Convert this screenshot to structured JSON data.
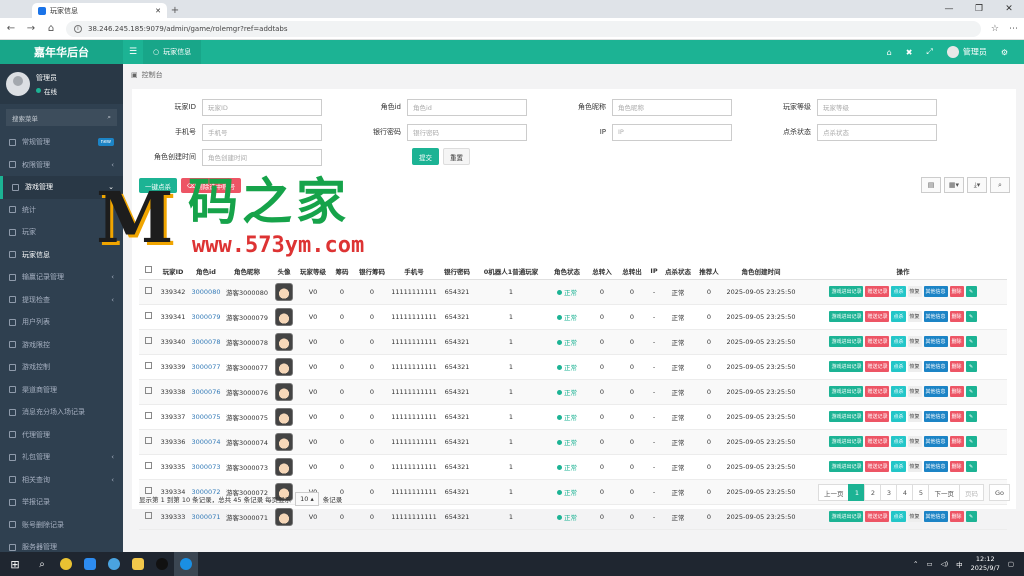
{
  "browser": {
    "tab_title": "玩家信息",
    "url": "38.246.245.185:9079/admin/game/rolemgr?ref=addtabs"
  },
  "app": {
    "brand": "嘉年华后台",
    "active_tab": "玩家信息",
    "admin_name": "管理员",
    "breadcrumb": "控制台"
  },
  "sidebar": {
    "user_name": "管理员",
    "user_status": "在线",
    "search_placeholder": "搜索菜单",
    "items": [
      {
        "label": "常规管理",
        "badge": "new",
        "arrow": ""
      },
      {
        "label": "权限管理",
        "badge": "",
        "arrow": "‹"
      },
      {
        "label": "游戏管理",
        "badge": "",
        "arrow": "⌄"
      },
      {
        "label": "统计",
        "badge": "",
        "arrow": ""
      },
      {
        "label": "玩家",
        "badge": "",
        "arrow": ""
      },
      {
        "label": "玩家信息",
        "badge": "",
        "arrow": ""
      },
      {
        "label": "输赢记录管理",
        "badge": "",
        "arrow": "‹"
      },
      {
        "label": "提现检查",
        "badge": "",
        "arrow": "‹"
      },
      {
        "label": "用户列表",
        "badge": "",
        "arrow": ""
      },
      {
        "label": "游戏限控",
        "badge": "",
        "arrow": ""
      },
      {
        "label": "游戏控制",
        "badge": "",
        "arrow": ""
      },
      {
        "label": "渠道商管理",
        "badge": "",
        "arrow": ""
      },
      {
        "label": "消息充分场入场记录",
        "badge": "",
        "arrow": ""
      },
      {
        "label": "代理管理",
        "badge": "",
        "arrow": ""
      },
      {
        "label": "礼包管理",
        "badge": "",
        "arrow": "‹"
      },
      {
        "label": "相关查询",
        "badge": "",
        "arrow": "‹"
      },
      {
        "label": "举报记录",
        "badge": "",
        "arrow": ""
      },
      {
        "label": "账号删除记录",
        "badge": "",
        "arrow": ""
      },
      {
        "label": "服务器管理",
        "badge": "",
        "arrow": ""
      }
    ]
  },
  "search_form": {
    "fields": [
      {
        "label": "玩家ID",
        "placeholder": "玩家ID"
      },
      {
        "label": "角色id",
        "placeholder": "角色id"
      },
      {
        "label": "角色昵称",
        "placeholder": "角色昵称"
      },
      {
        "label": "玩家等级",
        "placeholder": "玩家等级"
      },
      {
        "label": "手机号",
        "placeholder": "手机号"
      },
      {
        "label": "银行密码",
        "placeholder": "银行密码"
      },
      {
        "label": "IP",
        "placeholder": "IP"
      },
      {
        "label": "点杀状态",
        "placeholder": "点杀状态"
      },
      {
        "label": "角色创建时间",
        "placeholder": "角色创建时间"
      }
    ],
    "submit": "提交",
    "reset": "重置"
  },
  "toolbar": {
    "kill_all": "一键点杀",
    "delete_selected": "删除选中账号"
  },
  "table": {
    "headers": [
      "",
      "玩家ID",
      "角色id",
      "角色昵称",
      "头像",
      "玩家等级",
      "筹码",
      "银行筹码",
      "手机号",
      "银行密码",
      "0机器人1普通玩家",
      "角色状态",
      "总转入",
      "总转出",
      "IP",
      "点杀状态",
      "推荐人",
      "角色创建时间",
      "操作"
    ],
    "rows": [
      {
        "pid": "339342",
        "rid": "3000080",
        "nick": "游客3000080",
        "level": "V0",
        "chips": "0",
        "bank": "0",
        "phone": "11111111111",
        "bankpwd": "654321",
        "type": "1",
        "status": "正常",
        "in": "0",
        "out": "0",
        "ip": "-",
        "kill": "正常",
        "ref": "0",
        "created": "2025-09-05 23:25:50"
      },
      {
        "pid": "339341",
        "rid": "3000079",
        "nick": "游客3000079",
        "level": "V0",
        "chips": "0",
        "bank": "0",
        "phone": "11111111111",
        "bankpwd": "654321",
        "type": "1",
        "status": "正常",
        "in": "0",
        "out": "0",
        "ip": "-",
        "kill": "正常",
        "ref": "0",
        "created": "2025-09-05 23:25:50"
      },
      {
        "pid": "339340",
        "rid": "3000078",
        "nick": "游客3000078",
        "level": "V0",
        "chips": "0",
        "bank": "0",
        "phone": "11111111111",
        "bankpwd": "654321",
        "type": "1",
        "status": "正常",
        "in": "0",
        "out": "0",
        "ip": "-",
        "kill": "正常",
        "ref": "0",
        "created": "2025-09-05 23:25:50"
      },
      {
        "pid": "339339",
        "rid": "3000077",
        "nick": "游客3000077",
        "level": "V0",
        "chips": "0",
        "bank": "0",
        "phone": "11111111111",
        "bankpwd": "654321",
        "type": "1",
        "status": "正常",
        "in": "0",
        "out": "0",
        "ip": "-",
        "kill": "正常",
        "ref": "0",
        "created": "2025-09-05 23:25:50"
      },
      {
        "pid": "339338",
        "rid": "3000076",
        "nick": "游客3000076",
        "level": "V0",
        "chips": "0",
        "bank": "0",
        "phone": "11111111111",
        "bankpwd": "654321",
        "type": "1",
        "status": "正常",
        "in": "0",
        "out": "0",
        "ip": "-",
        "kill": "正常",
        "ref": "0",
        "created": "2025-09-05 23:25:50"
      },
      {
        "pid": "339337",
        "rid": "3000075",
        "nick": "游客3000075",
        "level": "V0",
        "chips": "0",
        "bank": "0",
        "phone": "11111111111",
        "bankpwd": "654321",
        "type": "1",
        "status": "正常",
        "in": "0",
        "out": "0",
        "ip": "-",
        "kill": "正常",
        "ref": "0",
        "created": "2025-09-05 23:25:50"
      },
      {
        "pid": "339336",
        "rid": "3000074",
        "nick": "游客3000074",
        "level": "V0",
        "chips": "0",
        "bank": "0",
        "phone": "11111111111",
        "bankpwd": "654321",
        "type": "1",
        "status": "正常",
        "in": "0",
        "out": "0",
        "ip": "-",
        "kill": "正常",
        "ref": "0",
        "created": "2025-09-05 23:25:50"
      },
      {
        "pid": "339335",
        "rid": "3000073",
        "nick": "游客3000073",
        "level": "V0",
        "chips": "0",
        "bank": "0",
        "phone": "11111111111",
        "bankpwd": "654321",
        "type": "1",
        "status": "正常",
        "in": "0",
        "out": "0",
        "ip": "-",
        "kill": "正常",
        "ref": "0",
        "created": "2025-09-05 23:25:50"
      },
      {
        "pid": "339334",
        "rid": "3000072",
        "nick": "游客3000072",
        "level": "V0",
        "chips": "0",
        "bank": "0",
        "phone": "11111111111",
        "bankpwd": "654321",
        "type": "1",
        "status": "正常",
        "in": "0",
        "out": "0",
        "ip": "-",
        "kill": "正常",
        "ref": "0",
        "created": "2025-09-05 23:25:50"
      },
      {
        "pid": "339333",
        "rid": "3000071",
        "nick": "游客3000071",
        "level": "V0",
        "chips": "0",
        "bank": "0",
        "phone": "11111111111",
        "bankpwd": "654321",
        "type": "1",
        "status": "正常",
        "in": "0",
        "out": "0",
        "ip": "-",
        "kill": "正常",
        "ref": "0",
        "created": "2025-09-05 23:25:50"
      }
    ],
    "row_actions": [
      "游戏进出记录",
      "赠送记录",
      "点杀",
      "恢复",
      "其他信息",
      "删除"
    ]
  },
  "pagination": {
    "info_prefix": "显示第 1 到第 10 条记录，总共 45 条记录 每页显示",
    "page_size": "10",
    "info_suffix": "条记录",
    "prev": "上一页",
    "pages": [
      "1",
      "2",
      "3",
      "4",
      "5"
    ],
    "current": "1",
    "next": "下一页",
    "jump_placeholder": "页码",
    "go": "Go"
  },
  "watermark": {
    "text": "码之家",
    "site": "www.573ym.com"
  },
  "taskbar": {
    "time": "12:12",
    "date": "2025/9/7"
  },
  "colors": {
    "primary": "#1cb394",
    "sidebar": "#2f4050",
    "danger": "#ed5565",
    "info": "#23c6c8",
    "link": "#1c84c6"
  }
}
